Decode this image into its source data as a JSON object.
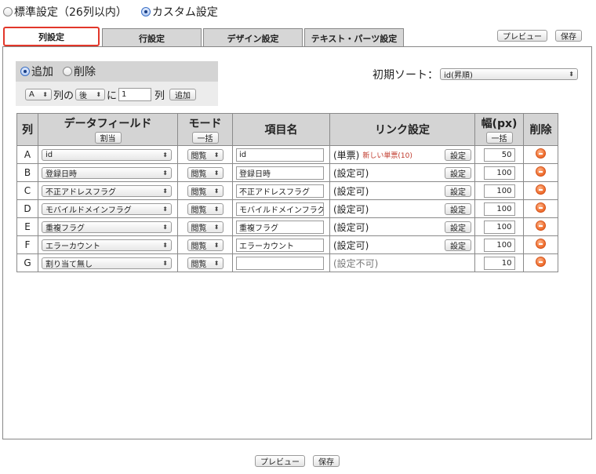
{
  "mode_radios": [
    {
      "label": "標準設定（26列以内）",
      "checked": false
    },
    {
      "label": "カスタム設定",
      "checked": true
    }
  ],
  "tabs": [
    {
      "label": "列設定",
      "active": true
    },
    {
      "label": "行設定",
      "active": false
    },
    {
      "label": "デザイン設定",
      "active": false
    },
    {
      "label": "テキスト・パーツ設定",
      "active": false
    }
  ],
  "top_buttons": {
    "preview": "プレビュー",
    "save": "保存"
  },
  "add_remove": {
    "radios": [
      {
        "label": "追加",
        "checked": true
      },
      {
        "label": "削除",
        "checked": false
      }
    ],
    "col_select": "A",
    "text_col_no": "列の",
    "position_select": "後",
    "text_ni": "に",
    "count_value": "1",
    "text_retsu": "列",
    "add_button": "追加"
  },
  "initial_sort": {
    "label": "初期ソート：",
    "value": "id(昇順)"
  },
  "table": {
    "headers": {
      "col": "列",
      "field": "データフィールド",
      "field_btn": "割当",
      "mode": "モード",
      "mode_btn": "一括",
      "item": "項目名",
      "link": "リンク設定",
      "width": "幅(px)",
      "width_btn": "一括",
      "delete": "削除"
    },
    "link_button": "設定",
    "rows": [
      {
        "col": "A",
        "field": "id",
        "mode": "閲覧",
        "item": "id",
        "link": "(単票)",
        "link_note": "新しい単票(10)",
        "has_link_btn": true,
        "width": "50"
      },
      {
        "col": "B",
        "field": "登録日時",
        "mode": "閲覧",
        "item": "登録日時",
        "link": "(設定可)",
        "link_note": "",
        "has_link_btn": true,
        "width": "100"
      },
      {
        "col": "C",
        "field": "不正アドレスフラグ",
        "mode": "閲覧",
        "item": "不正アドレスフラグ",
        "link": "(設定可)",
        "link_note": "",
        "has_link_btn": true,
        "width": "100"
      },
      {
        "col": "D",
        "field": "モバイルドメインフラグ",
        "mode": "閲覧",
        "item": "モバイルドメインフラグ",
        "link": "(設定可)",
        "link_note": "",
        "has_link_btn": true,
        "width": "100"
      },
      {
        "col": "E",
        "field": "重複フラグ",
        "mode": "閲覧",
        "item": "重複フラグ",
        "link": "(設定可)",
        "link_note": "",
        "has_link_btn": true,
        "width": "100"
      },
      {
        "col": "F",
        "field": "エラーカウント",
        "mode": "閲覧",
        "item": "エラーカウント",
        "link": "(設定可)",
        "link_note": "",
        "has_link_btn": true,
        "width": "100"
      },
      {
        "col": "G",
        "field": "割り当て無し",
        "mode": "閲覧",
        "item": "",
        "link": "(設定不可)",
        "link_note": "",
        "has_link_btn": false,
        "width": "10"
      }
    ]
  },
  "bottom_buttons": {
    "preview": "プレビュー",
    "save": "保存"
  },
  "icons": {
    "delete": "minus-circle-icon",
    "select_arrow": "updown-arrow-icon"
  },
  "colors": {
    "active_tab_border": "#e2372a",
    "delete_icon": "#ee6a2a",
    "link_note": "#c0392b"
  }
}
